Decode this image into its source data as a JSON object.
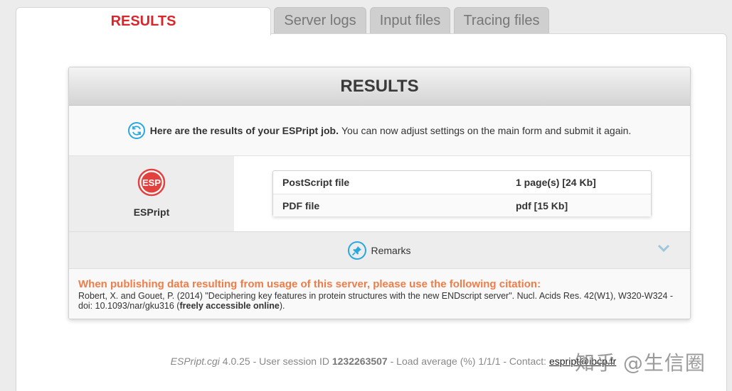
{
  "tabs": [
    {
      "label": "RESULTS",
      "active": true
    },
    {
      "label": "Server logs",
      "active": false
    },
    {
      "label": "Input files",
      "active": false
    },
    {
      "label": "Tracing files",
      "active": false
    }
  ],
  "panel": {
    "title": "RESULTS",
    "message_strong": "Here are the results of your ESPript job.",
    "message_rest": "You can now adjust settings on the main form and submit it again.",
    "esp_label": "ESPript",
    "esp_logo_text": "ESP",
    "files": [
      {
        "name": "PostScript file",
        "info": "1 page(s) [24 Kb]"
      },
      {
        "name": "PDF file",
        "info": "pdf [15 Kb]"
      }
    ],
    "remarks_label": "Remarks"
  },
  "citation": {
    "heading": "When publishing data resulting from usage of this server, please use the following citation:",
    "body": "Robert, X. and Gouet, P. (2014) \"Deciphering key features in protein structures with the new ENDscript server\". Nucl. Acids Res. 42(W1), W320-W324 - doi: 10.1093/nar/gku316 (",
    "link_text": "freely accessible online",
    "tail": ")."
  },
  "footer": {
    "app": "ESPript.cgi",
    "version": "4.0.25 - User session ID",
    "session_id": "1232263507",
    "load": "- Load average (%) 1/1/1 - Contact:",
    "contact": "espript@ibcp.fr"
  },
  "watermark": "知乎 @生信圈",
  "colors": {
    "active_tab": "#d9262b",
    "accent": "#29a8e0",
    "citation_heading": "#f07c48"
  }
}
